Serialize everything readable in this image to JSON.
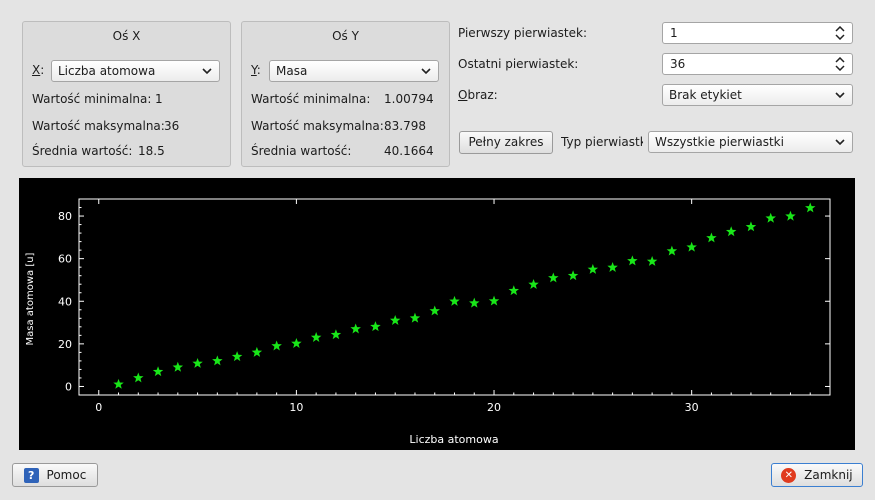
{
  "x_axis_group": {
    "title": "Oś X",
    "combo_prefix": "X",
    "combo_value": "Liczba atomowa",
    "min_label": "Wartość minimalna:",
    "min_value": "1",
    "max_label": "Wartość maksymalna:",
    "max_value": "36",
    "avg_label": "Średnia wartość:",
    "avg_value": "18.5"
  },
  "y_axis_group": {
    "title": "Oś Y",
    "combo_prefix": "Y",
    "combo_value": "Masa",
    "min_label": "Wartość minimalna:",
    "min_value": "1.00794",
    "max_label": "Wartość maksymalna:",
    "max_value": "83.798",
    "avg_label": "Średnia wartość:",
    "avg_value": "40.1664"
  },
  "settings": {
    "first_element_label": "Pierwszy pierwiastek:",
    "first_element_value": "1",
    "last_element_label": "Ostatni pierwiastek:",
    "last_element_value": "36",
    "image_label": "Obraz:",
    "image_value": "Brak etykiet",
    "full_range_button": "Pełny zakres",
    "element_type_label": "Typ pierwiastk",
    "element_type_value": "Wszystkie pierwiastki"
  },
  "footer": {
    "help_button": "Pomoc",
    "close_button": "Zamknij"
  },
  "colors": {
    "marker": "#19e619",
    "plot_bg": "#000000",
    "axis": "#ffffff"
  },
  "icons": {
    "help": "help-icon",
    "close": "close-icon",
    "dropdown": "chevron-down-icon",
    "spin": "spin-arrows-icon"
  },
  "chart_data": {
    "type": "scatter",
    "title": "",
    "xlabel": "Liczba atomowa",
    "ylabel": "Masa atomowa [u]",
    "xlim": [
      -1,
      37
    ],
    "ylim": [
      -4,
      88
    ],
    "xticks": [
      0,
      10,
      20,
      30
    ],
    "yticks": [
      0,
      20,
      40,
      60,
      80
    ],
    "marker": "star",
    "x": [
      1,
      2,
      3,
      4,
      5,
      6,
      7,
      8,
      9,
      10,
      11,
      12,
      13,
      14,
      15,
      16,
      17,
      18,
      19,
      20,
      21,
      22,
      23,
      24,
      25,
      26,
      27,
      28,
      29,
      30,
      31,
      32,
      33,
      34,
      35,
      36
    ],
    "y": [
      1.008,
      4.003,
      6.94,
      9.012,
      10.81,
      12.011,
      14.007,
      15.999,
      18.998,
      20.18,
      22.99,
      24.305,
      26.982,
      28.085,
      30.974,
      32.06,
      35.45,
      39.948,
      39.098,
      40.078,
      44.956,
      47.867,
      50.942,
      51.996,
      54.938,
      55.845,
      58.933,
      58.693,
      63.546,
      65.38,
      69.723,
      72.63,
      74.922,
      78.971,
      79.904,
      83.798
    ]
  }
}
